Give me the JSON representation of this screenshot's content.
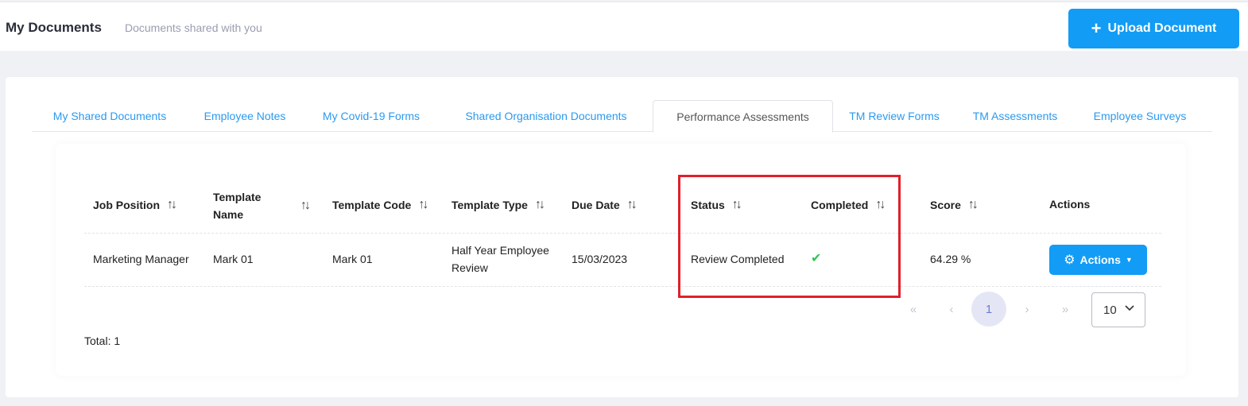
{
  "header": {
    "title": "My Documents",
    "subtitle": "Documents shared with you",
    "upload_label": "Upload Document",
    "upload_icon": "plus-icon"
  },
  "tabs": [
    {
      "label": "My Shared Documents",
      "active": false
    },
    {
      "label": "Employee Notes",
      "active": false
    },
    {
      "label": "My Covid-19 Forms",
      "active": false
    },
    {
      "label": "Shared Organisation Documents",
      "active": false
    },
    {
      "label": "Performance Assessments",
      "active": true
    },
    {
      "label": "TM Review Forms",
      "active": false
    },
    {
      "label": "TM Assessments",
      "active": false
    },
    {
      "label": "Employee Surveys",
      "active": false
    }
  ],
  "table": {
    "columns": [
      {
        "label": "Job Position",
        "sortable": true
      },
      {
        "label": "Template Name",
        "sortable": true
      },
      {
        "label": "Template Code",
        "sortable": true
      },
      {
        "label": "Template Type",
        "sortable": true
      },
      {
        "label": "Due Date",
        "sortable": true
      },
      {
        "label": "Status",
        "sortable": true
      },
      {
        "label": "Completed",
        "sortable": true
      },
      {
        "label": "Score",
        "sortable": true
      },
      {
        "label": "Actions",
        "sortable": false
      }
    ],
    "rows": [
      {
        "job_position": "Marketing Manager",
        "template_name": "Mark 01",
        "template_code": "Mark 01",
        "template_type": "Half Year Employee Review",
        "due_date": "15/03/2023",
        "status": "Review Completed",
        "completed": true,
        "score": "64.29 %",
        "actions_label": "Actions"
      }
    ]
  },
  "pagination": {
    "first": "«",
    "prev": "‹",
    "current": "1",
    "next": "›",
    "last": "»",
    "page_size": "10"
  },
  "total_label": "Total: 1",
  "colors": {
    "accent": "#129cf5",
    "tab_link": "#2a9af0",
    "check": "#33c45a",
    "highlight": "#e0202a"
  }
}
